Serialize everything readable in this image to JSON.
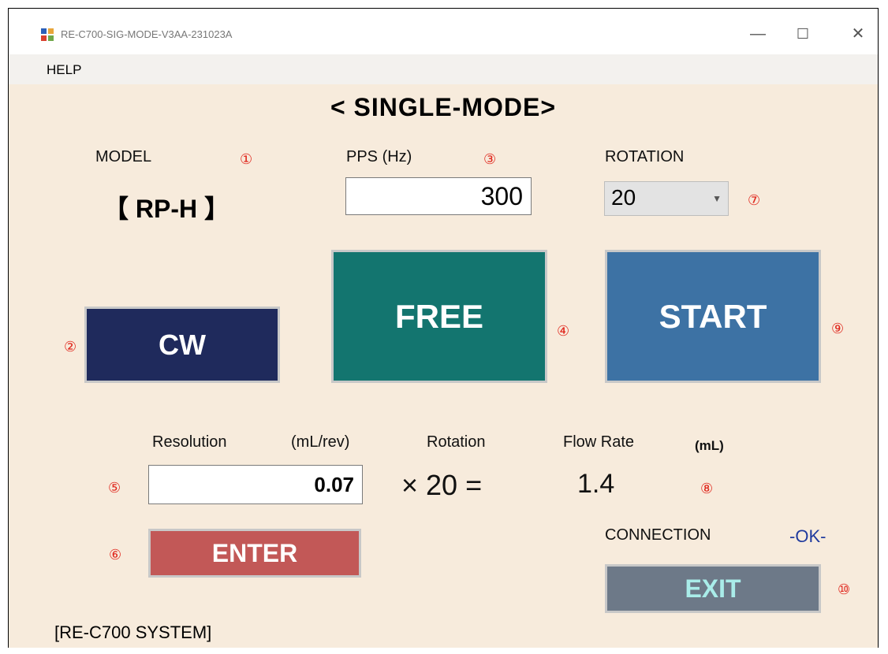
{
  "window": {
    "title": "RE-C700-SIG-MODE-V3AA-231023A",
    "minimize_glyph": "—",
    "maximize_glyph": "☐",
    "close_glyph": "✕"
  },
  "menu": {
    "help": "HELP"
  },
  "heading": "< SINGLE-MODE>",
  "model": {
    "label": "MODEL",
    "value": "【 RP-H 】",
    "marker": "①"
  },
  "pps": {
    "label": "PPS (Hz)",
    "value": "300",
    "marker": "③"
  },
  "rotation_select": {
    "label": "ROTATION",
    "value": "20",
    "marker": "⑦"
  },
  "buttons": {
    "cw": "CW",
    "cw_marker": "②",
    "free": "FREE",
    "free_marker": "④",
    "start": "START",
    "start_marker": "⑨",
    "enter": "ENTER",
    "enter_marker": "⑥",
    "exit": "EXIT",
    "exit_marker": "⑩"
  },
  "calc": {
    "resolution_label": "Resolution",
    "resolution_unit": "(mL/rev)",
    "rotation_label": "Rotation",
    "flow_label": "Flow Rate",
    "flow_unit": "(mL)",
    "resolution_value": "0.07",
    "resolution_marker": "⑤",
    "multiplier": "× 20 =",
    "flow_value": "1.4",
    "flow_marker": "⑧"
  },
  "connection": {
    "label": "CONNECTION",
    "status": "-OK-"
  },
  "footer": "[RE-C700 SYSTEM]",
  "colors": {
    "background": "#f7ebdc",
    "cw": "#1f2a5c",
    "free": "#13756f",
    "start": "#3d72a4",
    "enter": "#c25857",
    "exit": "#6d7988",
    "marker": "#e0251b",
    "ok": "#1f3a9e"
  }
}
